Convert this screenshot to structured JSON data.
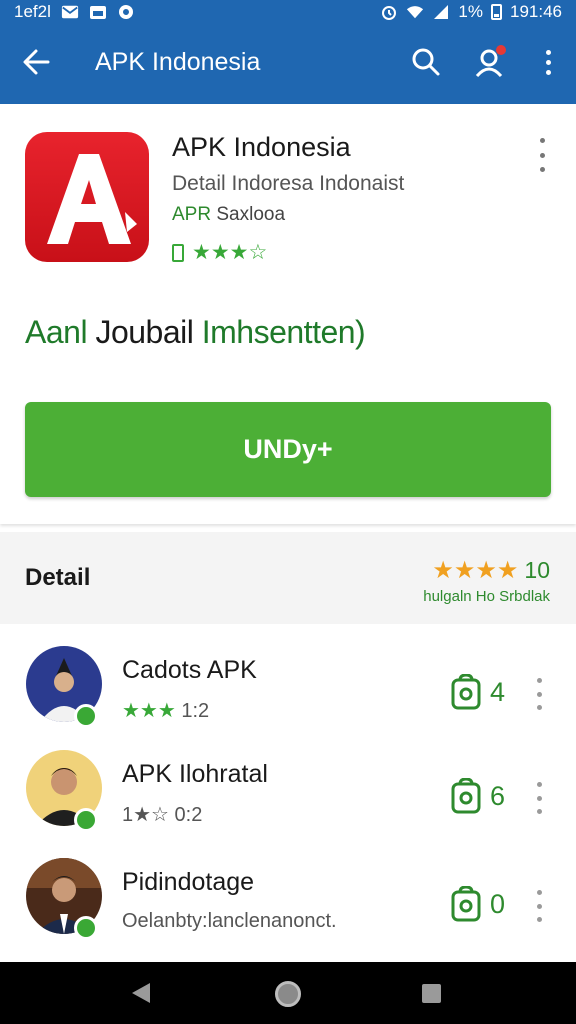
{
  "status_bar": {
    "left_text": "1ef2l",
    "battery_text": "1%",
    "time": "191:46",
    "icons": [
      "mail-icon",
      "calendar-icon",
      "sync-icon",
      "alarm-icon",
      "wifi-icon",
      "signal-icon",
      "battery-icon"
    ]
  },
  "app_bar": {
    "title": "APK Indonesia",
    "icons": [
      "back-arrow-icon",
      "search-icon",
      "account-icon",
      "more-vert-icon"
    ],
    "notification_color": "#e53935"
  },
  "app_header": {
    "name": "APK Indonesia",
    "description": "Detail Indoresa Indonaist",
    "developer_label": "APR",
    "developer_name": "Saxlooa",
    "rating_stars": "★★★☆",
    "rating_value": 3,
    "icon_letter": "A",
    "brand_color": "#d7191f"
  },
  "subtitle": {
    "part1": "Aanl",
    "part2": "Joubail",
    "part3": "Imhsentten)"
  },
  "install_button": {
    "label": "UNDy+",
    "color": "#4caf36"
  },
  "detail": {
    "title": "Detail",
    "stars": "★★★★",
    "count": "10",
    "subtitle": "hulgaln Ho Srbdlak"
  },
  "list_items": [
    {
      "title": "Cadots APK",
      "stars": "★★★",
      "meta": "1:2",
      "count": "4"
    },
    {
      "title": "APK Ilohratal",
      "stars": "1★☆",
      "meta": "0:2",
      "count": "6"
    },
    {
      "title": "Pidindotage",
      "stars": "",
      "meta": "Oelanbty:lanclenanonct.",
      "count": "0"
    }
  ],
  "nav_bar": {
    "icons": [
      "nav-back-icon",
      "nav-home-icon",
      "nav-recents-icon"
    ]
  },
  "colors": {
    "primary": "#1f67b1",
    "accent_green": "#4caf36",
    "star_orange": "#f0a020"
  }
}
